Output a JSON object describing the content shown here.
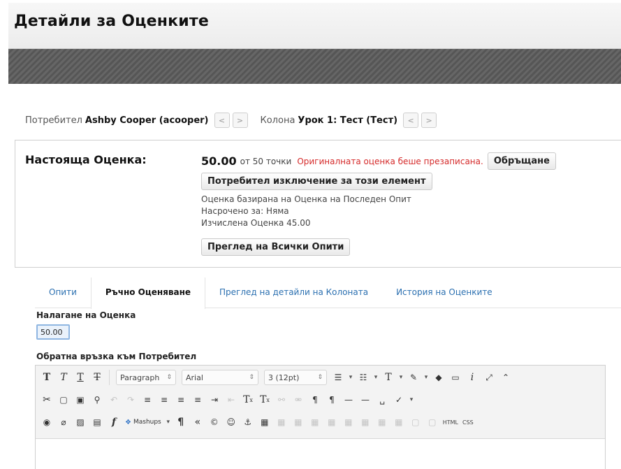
{
  "header": {
    "title": "Детайли за Оценките"
  },
  "nav": {
    "user_label": "Потребител",
    "user_value": "Ashby Cooper (acooper)",
    "column_label": "Колона",
    "column_value": "Урок 1: Тест (Тест)",
    "prev_glyph": "<",
    "next_glyph": ">"
  },
  "grade": {
    "label": "Настояща Оценка:",
    "value": "50.00",
    "suffix": "от 50 точки",
    "override_note": "Оригиналната оценка беше презаписана.",
    "revert_button": "Обръщане",
    "exempt_button": "Потребител изключение за този елемент",
    "based_on": "Оценка базирана на Оценка на Последен Опит",
    "due": "Насрочено за: Няма",
    "calculated": "Изчислена Оценка  45.00",
    "view_attempts_button": "Преглед на Всички Опити"
  },
  "tabs": [
    {
      "label": "Опити"
    },
    {
      "label": "Ръчно Оценяване"
    },
    {
      "label": "Преглед на детайли на Колоната"
    },
    {
      "label": "История на Оценките"
    }
  ],
  "override": {
    "title": "Налагане на Оценка",
    "value": "50.00"
  },
  "feedback": {
    "title": "Обратна връзка към Потребител"
  },
  "editor": {
    "format_select": "Paragraph",
    "font_select": "Arial",
    "size_select": "3 (12pt)",
    "mashups": "Mashups",
    "html_button": "HTML",
    "css_button": "CSS"
  }
}
